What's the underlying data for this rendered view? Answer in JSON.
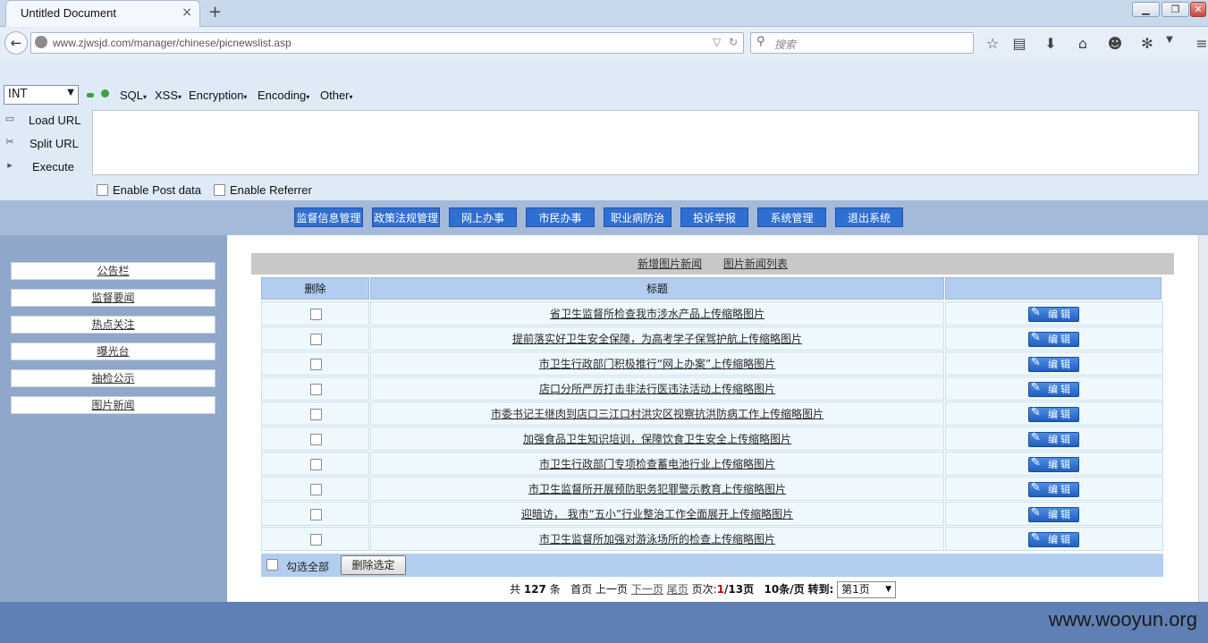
{
  "browser": {
    "tab_title": "Untitled Document",
    "tab_close": "×",
    "new_tab": "+",
    "url": "www.zjwsjd.com/manager/chinese/picnewslist.asp",
    "search_placeholder": "搜索",
    "window_controls": [
      "▁",
      "❐",
      "✕"
    ]
  },
  "hackbar": {
    "type_select": "INT",
    "menus": [
      "SQL",
      "XSS",
      "Encryption",
      "Encoding",
      "Other"
    ],
    "actions": [
      "Load URL",
      "Split URL",
      "Execute"
    ],
    "post_data_label": "Enable Post data",
    "referrer_label": "Enable Referrer",
    "textarea_value": ""
  },
  "site": {
    "top_nav": [
      "监督信息管理",
      "政策法规管理",
      "网上办事",
      "市民办事",
      "职业病防治",
      "投诉举报",
      "系统管理",
      "退出系统"
    ],
    "sidebar": [
      "公告栏",
      "监督要闻",
      "热点关注",
      "曝光台",
      "抽检公示",
      "图片新闻"
    ],
    "links": [
      "新增图片新闻",
      "图片新闻列表"
    ],
    "table": {
      "headers": [
        "删除",
        "标题",
        ""
      ],
      "edit_label": "编辑",
      "rows": [
        "省卫生监督所检查我市涉水产品上传缩略图片",
        "提前落实好卫生安全保障，为高考学子保驾护航上传缩略图片",
        "市卫生行政部门积极推行“网上办案”上传缩略图片",
        "店口分所严厉打击非法行医违法活动上传缩略图片",
        "市委书记王继肉到店口三江口村洪灾区视察抗洪防病工作上传缩略图片",
        "加强食品卫生知识培训，保障饮食卫生安全上传缩略图片",
        "市卫生行政部门专项检查蓄电池行业上传缩略图片",
        "市卫生监督所开展预防职务犯罪警示教育上传缩略图片",
        "迎暗访，  我市“五小”行业整治工作全面展开上传缩略图片",
        "市卫生监督所加强对游泳场所的检查上传缩略图片"
      ],
      "select_all_label": "勾选全部",
      "delete_selected_label": "删除选定"
    },
    "pager": {
      "total_prefix": "共",
      "total": "127",
      "total_suffix": "条",
      "first": "首页",
      "prev": "上一页",
      "next": "下一页",
      "last": "尾页",
      "page_label": "页次:",
      "current": "1",
      "pages": "/13页",
      "per_page": "10条/页",
      "goto_label": "转到:",
      "goto_value": "第1页"
    },
    "watermark": "www.wooyun.org"
  }
}
